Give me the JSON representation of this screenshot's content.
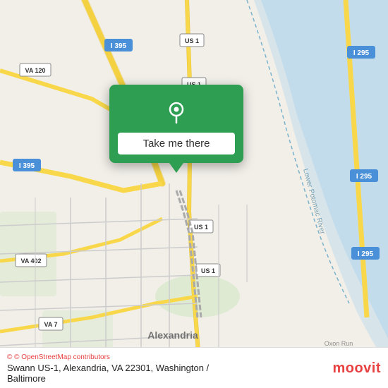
{
  "map": {
    "popup": {
      "button_label": "Take me there",
      "pin_color": "#ffffff"
    },
    "attribution": "© OpenStreetMap contributors",
    "address": "Swann US-1, Alexandria, VA 22301, Washington /",
    "city": "Baltimore"
  },
  "branding": {
    "logo_text": "moovit",
    "logo_symbol": "m"
  },
  "colors": {
    "green": "#2e9e52",
    "red": "#e84141",
    "road_yellow": "#f8d84a",
    "road_white": "#ffffff",
    "map_bg": "#f2efe9",
    "water": "#b3d4e8",
    "park": "#d5e8c7"
  }
}
